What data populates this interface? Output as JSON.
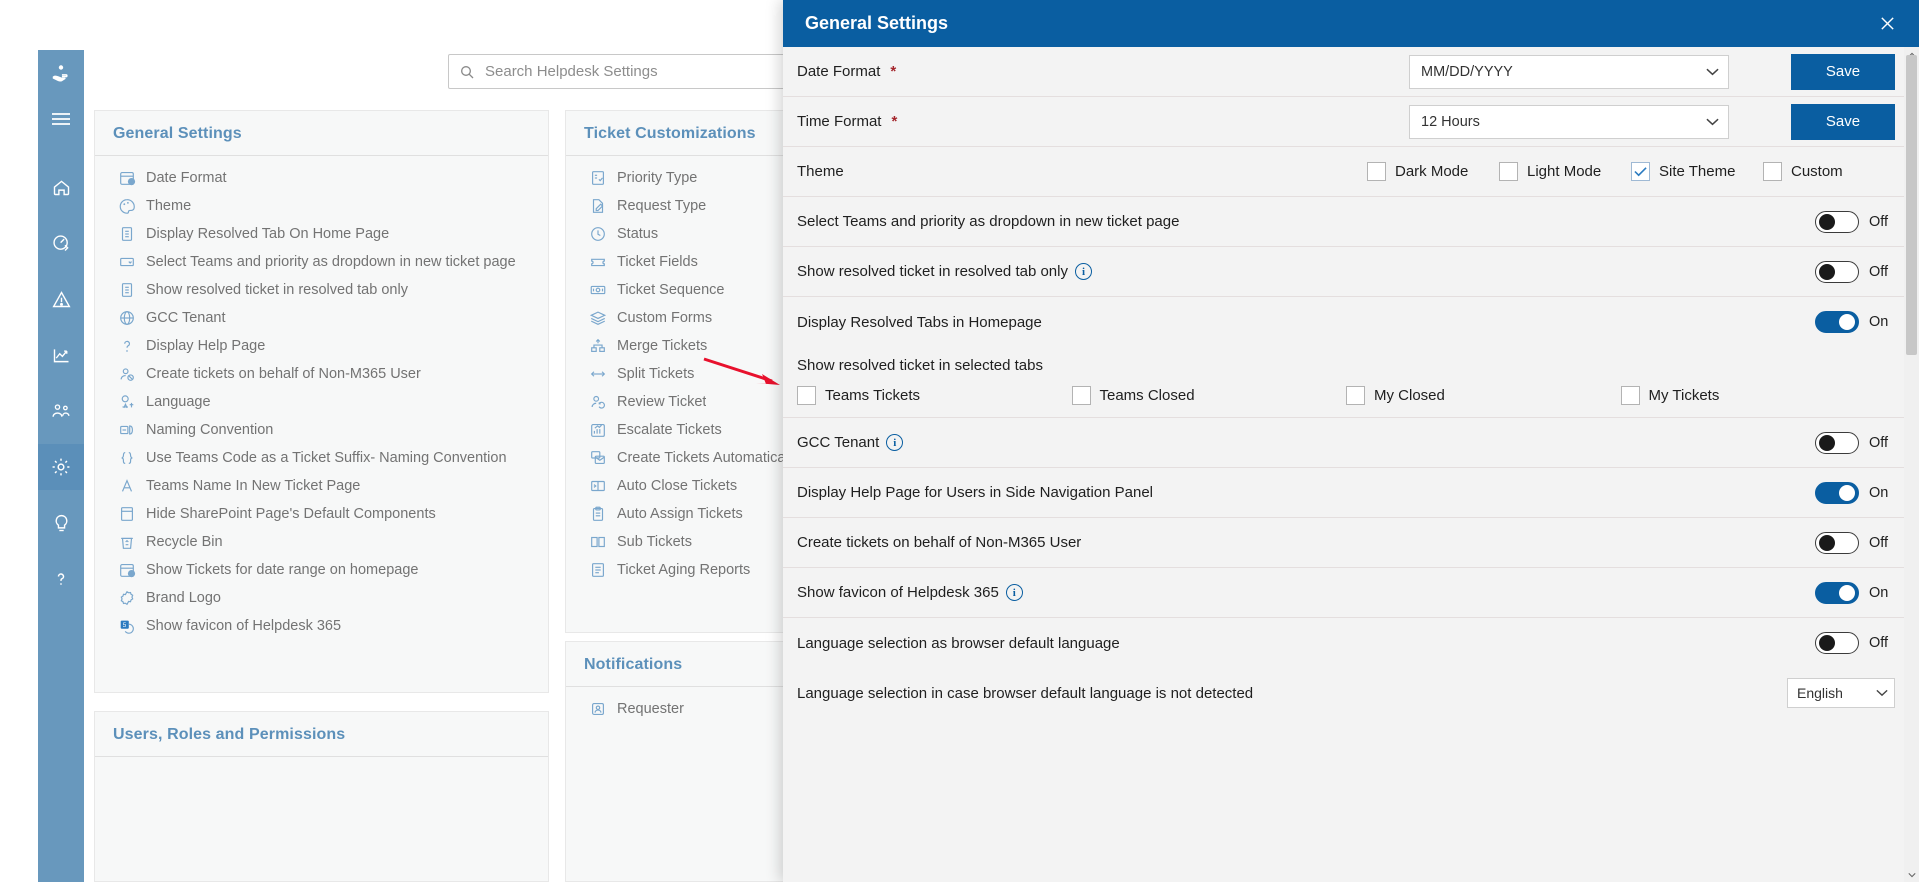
{
  "rail": {
    "items": [
      {
        "name": "helpdesk-logo-icon",
        "label": "Helpdesk"
      },
      {
        "name": "hamburger-menu-icon",
        "label": "Menu"
      },
      {
        "name": "home-icon",
        "label": "Home"
      },
      {
        "name": "dashboard-icon",
        "label": "Dashboard"
      },
      {
        "name": "alerts-icon",
        "label": "Alerts"
      },
      {
        "name": "analytics-icon",
        "label": "Analytics"
      },
      {
        "name": "teams-icon",
        "label": "Teams"
      },
      {
        "name": "settings-gear-icon",
        "label": "Settings"
      },
      {
        "name": "ideas-bulb-icon",
        "label": "Ideas"
      },
      {
        "name": "help-icon",
        "label": "Help"
      }
    ]
  },
  "search": {
    "placeholder": "Search Helpdesk Settings",
    "value": "",
    "icon": "search-icon"
  },
  "columns": {
    "general": {
      "title": "General Settings",
      "items": [
        {
          "label": "Date Format",
          "icon": "calendar-clock-icon"
        },
        {
          "label": "Theme",
          "icon": "palette-icon"
        },
        {
          "label": "Display Resolved Tab On Home Page",
          "icon": "document-icon"
        },
        {
          "label": "Select Teams and priority as dropdown in new ticket page",
          "icon": "dropdown-icon"
        },
        {
          "label": "Show resolved ticket in resolved tab only",
          "icon": "document-icon"
        },
        {
          "label": "GCC Tenant",
          "icon": "globe-icon"
        },
        {
          "label": "Display Help Page",
          "icon": "question-icon"
        },
        {
          "label": "Create tickets on behalf of Non-M365 User",
          "icon": "user-block-icon"
        },
        {
          "label": "Language",
          "icon": "language-icon"
        },
        {
          "label": "Naming Convention",
          "icon": "naming-icon"
        },
        {
          "label": "Use Teams Code as a Ticket Suffix- Naming Convention",
          "icon": "braces-icon"
        },
        {
          "label": "Teams Name In New Ticket Page",
          "icon": "font-icon"
        },
        {
          "label": "Hide SharePoint Page's Default Components",
          "icon": "page-icon"
        },
        {
          "label": "Recycle Bin",
          "icon": "recycle-bin-icon"
        },
        {
          "label": "Show Tickets for date range on homepage",
          "icon": "calendar-clock-icon"
        },
        {
          "label": "Brand Logo",
          "icon": "badge-icon"
        },
        {
          "label": "Show favicon of Helpdesk 365",
          "icon": "favicon-icon"
        }
      ]
    },
    "users": {
      "title": "Users, Roles and Permissions",
      "items": []
    },
    "ticket": {
      "title": "Ticket Customizations",
      "items": [
        {
          "label": "Priority Type",
          "icon": "list-check-icon"
        },
        {
          "label": "Request Type",
          "icon": "edit-doc-icon"
        },
        {
          "label": "Status",
          "icon": "clock-check-icon"
        },
        {
          "label": "Ticket Fields",
          "icon": "ticket-icon"
        },
        {
          "label": "Ticket Sequence",
          "icon": "sequence-icon"
        },
        {
          "label": "Custom Forms",
          "icon": "layers-icon"
        },
        {
          "label": "Merge Tickets",
          "icon": "merge-icon"
        },
        {
          "label": "Split Tickets",
          "icon": "split-icon"
        },
        {
          "label": "Review Ticket",
          "icon": "review-users-icon"
        },
        {
          "label": "Escalate Tickets",
          "icon": "escalate-chart-icon"
        },
        {
          "label": "Create Tickets Automatically",
          "icon": "mail-create-icon"
        },
        {
          "label": "Auto Close Tickets",
          "icon": "auto-close-icon"
        },
        {
          "label": "Auto Assign Tickets",
          "icon": "clipboard-icon"
        },
        {
          "label": "Sub Tickets",
          "icon": "columns-icon"
        },
        {
          "label": "Ticket Aging Reports",
          "icon": "report-icon"
        }
      ]
    },
    "notifications": {
      "title": "Notifications",
      "items": [
        {
          "label": "Requester",
          "icon": "requester-icon"
        }
      ]
    }
  },
  "dialog": {
    "title": "General Settings",
    "close_icon": "close-icon",
    "date_format": {
      "label": "Date Format",
      "required": "*",
      "value": "MM/DD/YYYY",
      "save_label": "Save"
    },
    "time_format": {
      "label": "Time Format",
      "required": "*",
      "value": "12 Hours",
      "save_label": "Save"
    },
    "theme": {
      "label": "Theme",
      "options": [
        {
          "label": "Dark Mode",
          "checked": false
        },
        {
          "label": "Light Mode",
          "checked": false
        },
        {
          "label": "Site Theme",
          "checked": true
        },
        {
          "label": "Custom",
          "checked": false
        }
      ]
    },
    "toggles": [
      {
        "label": "Select Teams and priority as dropdown in new ticket page",
        "state": "Off",
        "on": false,
        "info": false
      },
      {
        "label": "Show resolved ticket in resolved tab only",
        "state": "Off",
        "on": false,
        "info": true
      },
      {
        "label": "Display Resolved Tabs in Homepage",
        "state": "On",
        "on": true,
        "info": false
      }
    ],
    "selected_tabs": {
      "label": "Show resolved ticket in selected tabs",
      "options": [
        {
          "label": "Teams Tickets",
          "checked": false
        },
        {
          "label": "Teams Closed",
          "checked": false
        },
        {
          "label": "My Closed",
          "checked": false
        },
        {
          "label": "My Tickets",
          "checked": false
        }
      ]
    },
    "toggles2": [
      {
        "label": "GCC Tenant",
        "state": "Off",
        "on": false,
        "info": true
      },
      {
        "label": "Display Help Page for Users in Side Navigation Panel",
        "state": "On",
        "on": true,
        "info": false
      },
      {
        "label": "Create tickets on behalf of Non-M365 User",
        "state": "Off",
        "on": false,
        "info": false
      },
      {
        "label": "Show favicon of Helpdesk 365",
        "state": "On",
        "on": true,
        "info": true
      },
      {
        "label": "Language selection as browser default language",
        "state": "Off",
        "on": false,
        "info": false
      }
    ],
    "language_row": {
      "label": "Language selection in case browser default language is not detected",
      "value": "English"
    }
  },
  "colors": {
    "brand_blue": "#0a5ea1",
    "rail_blue": "#6898bd",
    "heading_blue": "#5c90ba",
    "arrow_red": "#e8112d"
  }
}
